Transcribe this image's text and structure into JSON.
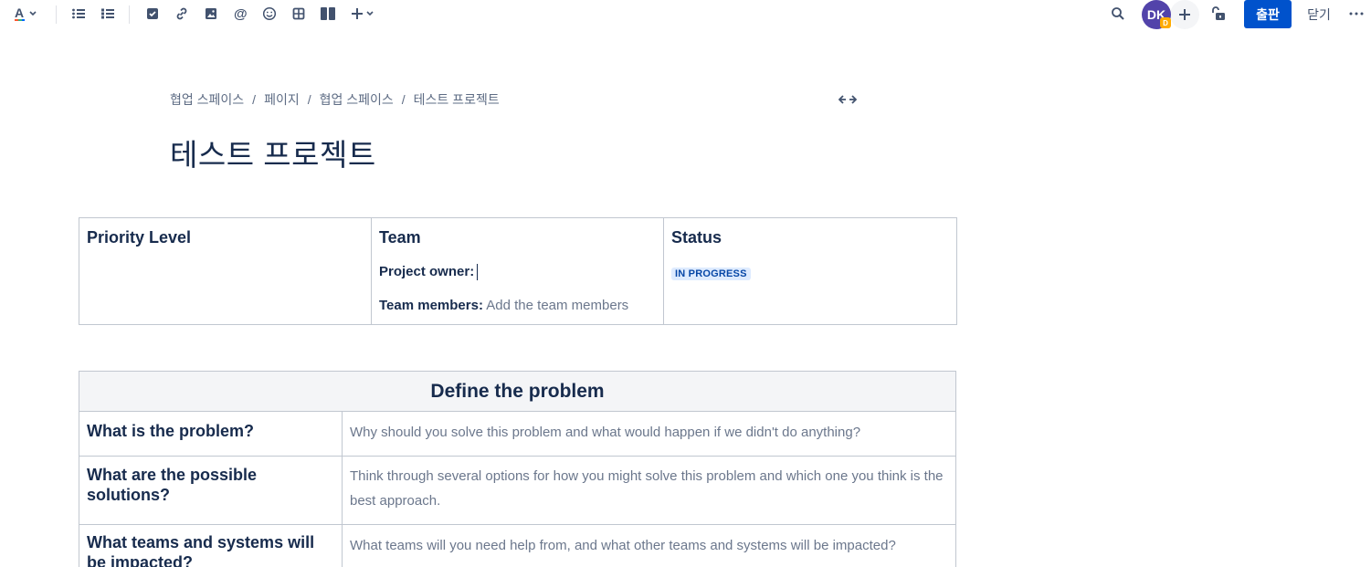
{
  "toolbar": {
    "text_color_icon": "text-color-icon",
    "icons": [
      "bullet-list-icon",
      "numbered-list-icon",
      "task-icon",
      "link-icon",
      "image-icon",
      "mention-icon",
      "emoji-icon",
      "table-icon",
      "layout-icon",
      "insert-icon"
    ],
    "avatar_initials": "DK",
    "avatar_badge": "D",
    "publish_label": "출판",
    "close_label": "닫기",
    "accent": "#0052cc",
    "avatar_color": "#5243aa"
  },
  "breadcrumb": [
    "협업 스페이스",
    "페이지",
    "협업 스페이스",
    "테스트 프로젝트"
  ],
  "breadcrumb_sep": "/",
  "page_title": "테스트 프로젝트",
  "summary_table": {
    "priority_header": "Priority Level",
    "team_header": "Team",
    "status_header": "Status",
    "project_owner_label": "Project owner:",
    "team_members_label": "Team members:",
    "team_members_placeholder": "Add the team members",
    "status_lozenge": "IN PROGRESS"
  },
  "problem_table": {
    "header": "Define the problem",
    "rows": [
      {
        "question": "What is the problem?",
        "answer": "Why should you solve this problem and what would happen if we didn't do anything?"
      },
      {
        "question": "What are the possible solutions?",
        "answer": "Think through several options for how you might solve this problem and which one you think is the best approach."
      },
      {
        "question": "What teams and systems will be impacted?",
        "answer": "What teams will you need help from, and what other teams and systems will be impacted?"
      }
    ]
  }
}
